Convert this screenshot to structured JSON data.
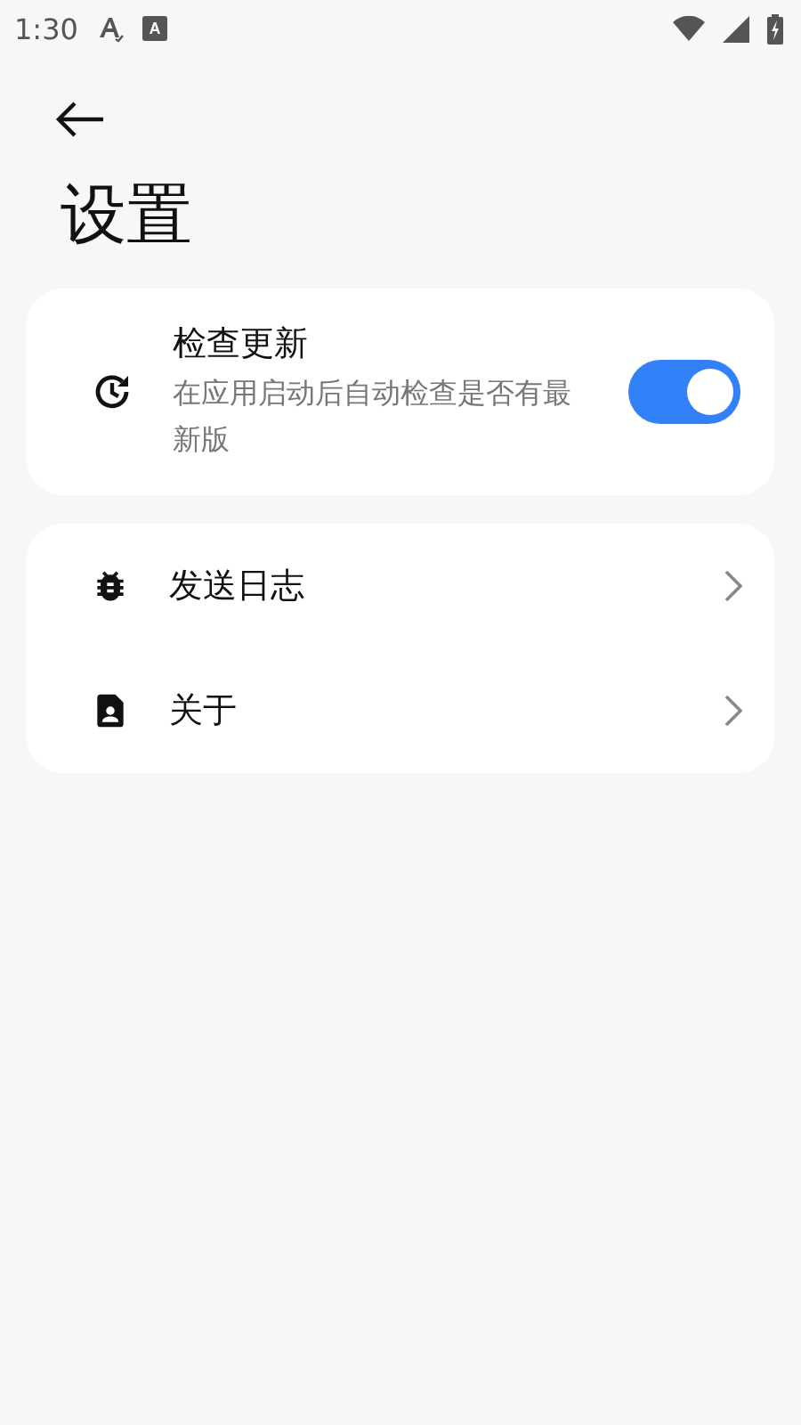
{
  "status_bar": {
    "time": "1:30"
  },
  "title": "设置",
  "update_card": {
    "title": "检查更新",
    "description": "在应用启动后自动检查是否有最新版",
    "on": true
  },
  "menu_items": [
    {
      "kind": "bug",
      "label": "发送日志"
    },
    {
      "kind": "about",
      "label": "关于"
    }
  ]
}
